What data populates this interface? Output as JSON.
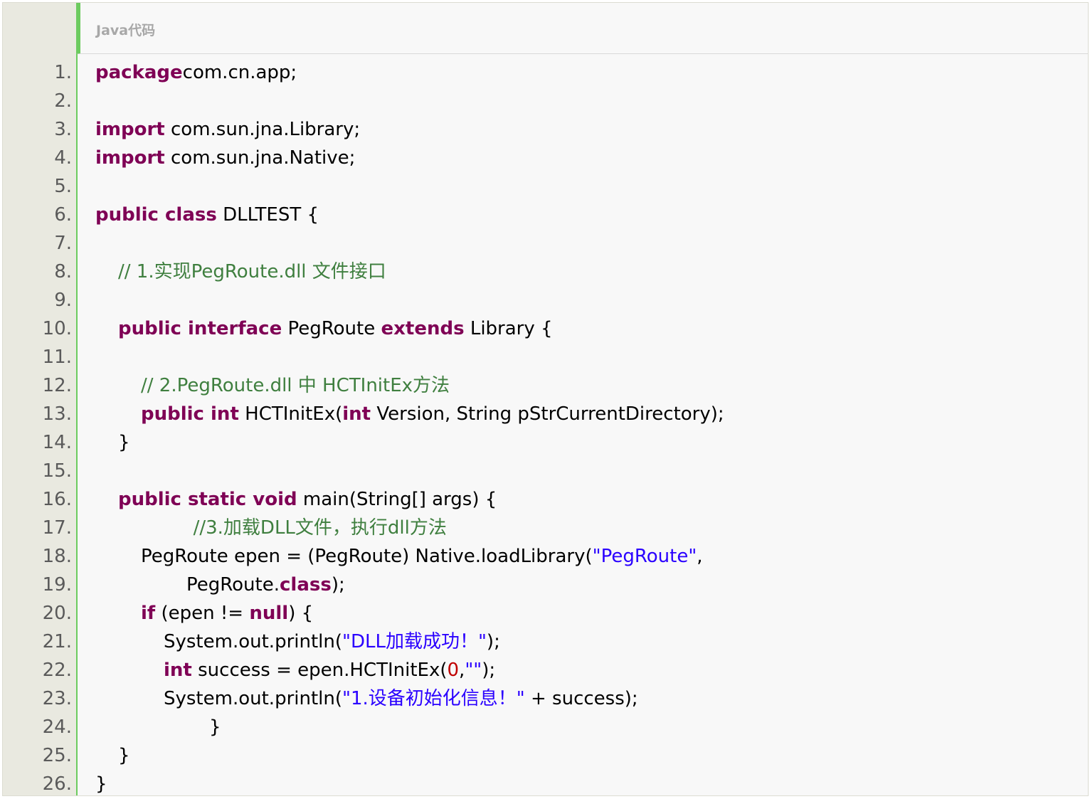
{
  "header": {
    "title": "Java代码"
  },
  "colors": {
    "keyword": "#7f0055",
    "comment": "#3f7f3f",
    "string": "#2a00ff",
    "number": "#c00000",
    "accent": "#6ccb5f"
  },
  "lines": [
    {
      "num": "1.",
      "indent": 0,
      "tokens": [
        [
          "kw",
          "package"
        ],
        [
          "",
          "com.cn.app;"
        ]
      ]
    },
    {
      "num": "2.",
      "indent": 0,
      "tokens": []
    },
    {
      "num": "3.",
      "indent": 0,
      "tokens": [
        [
          "kw",
          "import"
        ],
        [
          "",
          " com.sun.jna.Library;"
        ]
      ]
    },
    {
      "num": "4.",
      "indent": 0,
      "tokens": [
        [
          "kw",
          "import"
        ],
        [
          "",
          " com.sun.jna.Native;"
        ]
      ]
    },
    {
      "num": "5.",
      "indent": 0,
      "tokens": []
    },
    {
      "num": "6.",
      "indent": 0,
      "tokens": [
        [
          "kw",
          "public class"
        ],
        [
          "",
          " DLLTEST {"
        ]
      ]
    },
    {
      "num": "7.",
      "indent": 0,
      "tokens": []
    },
    {
      "num": "8.",
      "indent": 1,
      "tokens": [
        [
          "cm",
          "// 1.实现PegRoute.dll 文件接口"
        ]
      ]
    },
    {
      "num": "9.",
      "indent": 0,
      "tokens": []
    },
    {
      "num": "10.",
      "indent": 1,
      "tokens": [
        [
          "kw",
          "public interface"
        ],
        [
          "",
          " PegRoute "
        ],
        [
          "kw",
          "extends"
        ],
        [
          "",
          " Library {"
        ]
      ]
    },
    {
      "num": "11.",
      "indent": 0,
      "tokens": []
    },
    {
      "num": "12.",
      "indent": 2,
      "tokens": [
        [
          "cm",
          "// 2.PegRoute.dll 中 HCTInitEx方法"
        ]
      ]
    },
    {
      "num": "13.",
      "indent": 2,
      "tokens": [
        [
          "kw",
          "public int"
        ],
        [
          "",
          " HCTInitEx("
        ],
        [
          "kw",
          "int"
        ],
        [
          "",
          " Version, String pStrCurrentDirectory);"
        ]
      ]
    },
    {
      "num": "14.",
      "indent": 1,
      "tokens": [
        [
          "",
          "}"
        ]
      ]
    },
    {
      "num": "15.",
      "indent": 0,
      "tokens": []
    },
    {
      "num": "16.",
      "indent": 1,
      "tokens": [
        [
          "kw",
          "public static void"
        ],
        [
          "",
          " main(String[] args) {"
        ]
      ]
    },
    {
      "num": "17.",
      "indent": 4.3,
      "tokens": [
        [
          "cm",
          "//3.加载DLL文件，执行dll方法"
        ]
      ]
    },
    {
      "num": "18.",
      "indent": 2,
      "tokens": [
        [
          "",
          "PegRoute epen = (PegRoute) Native.loadLibrary("
        ],
        [
          "st",
          "\"PegRoute\""
        ],
        [
          "",
          ","
        ]
      ]
    },
    {
      "num": "19.",
      "indent": 4,
      "tokens": [
        [
          "",
          "PegRoute."
        ],
        [
          "kw",
          "class"
        ],
        [
          "",
          ");"
        ]
      ]
    },
    {
      "num": "20.",
      "indent": 2,
      "tokens": [
        [
          "kw",
          "if"
        ],
        [
          "",
          " (epen != "
        ],
        [
          "kw",
          "null"
        ],
        [
          "",
          ") {"
        ]
      ]
    },
    {
      "num": "21.",
      "indent": 3,
      "tokens": [
        [
          "",
          "System.out.println("
        ],
        [
          "st",
          "\"DLL加载成功！\""
        ],
        [
          "",
          ");"
        ]
      ]
    },
    {
      "num": "22.",
      "indent": 3,
      "tokens": [
        [
          "kw",
          "int"
        ],
        [
          "",
          " success = epen.HCTInitEx("
        ],
        [
          "nm",
          "0"
        ],
        [
          "",
          ","
        ],
        [
          "st",
          "\"\""
        ],
        [
          "",
          ");"
        ]
      ]
    },
    {
      "num": "23.",
      "indent": 3,
      "tokens": [
        [
          "",
          "System.out.println("
        ],
        [
          "st",
          "\"1.设备初始化信息！\""
        ],
        [
          "",
          " + success);"
        ]
      ]
    },
    {
      "num": "24.",
      "indent": 5,
      "tokens": [
        [
          "",
          "}"
        ]
      ]
    },
    {
      "num": "25.",
      "indent": 1,
      "tokens": [
        [
          "",
          "}"
        ]
      ]
    },
    {
      "num": "26.",
      "indent": 0,
      "tokens": [
        [
          "",
          "}"
        ]
      ]
    }
  ]
}
